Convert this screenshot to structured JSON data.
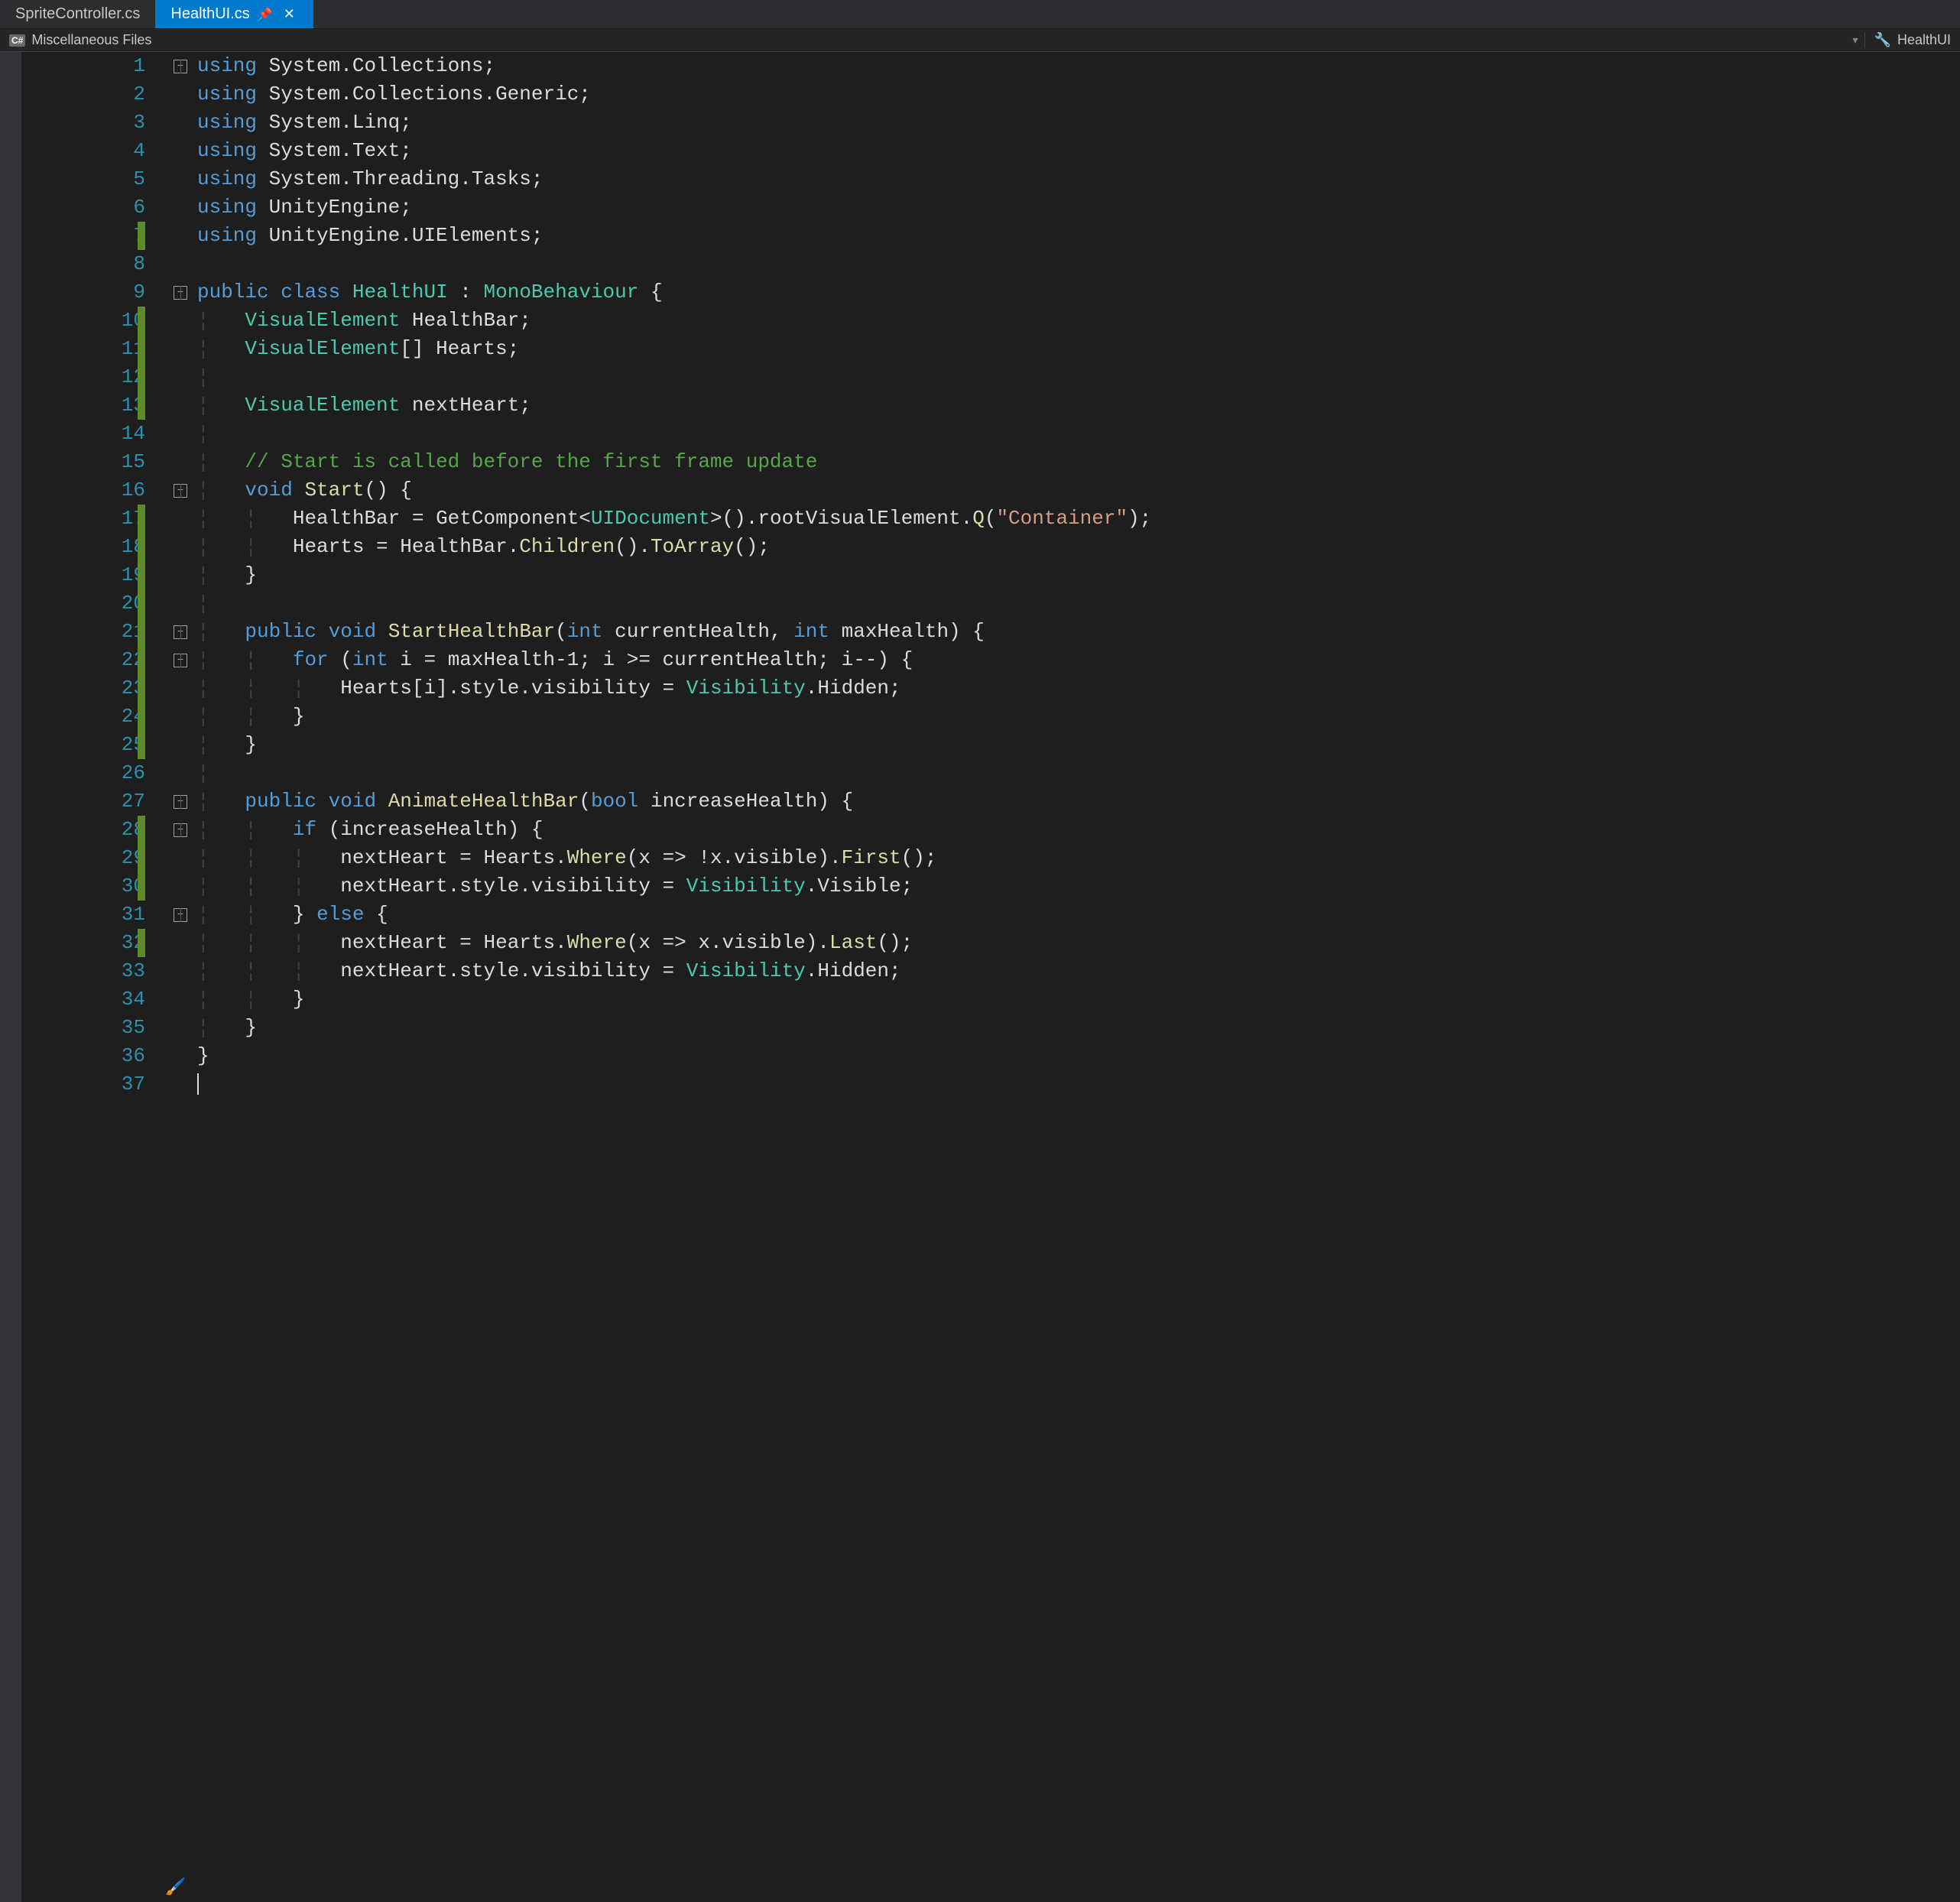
{
  "tabs": {
    "inactive": "SpriteController.cs",
    "active": "HealthUI.cs"
  },
  "context": {
    "left_label": "Miscellaneous Files",
    "right_label": "HealthUI"
  },
  "lines": [
    {
      "n": "1",
      "fold": "minus",
      "mark": false,
      "html": "<span class='kw'>using</span> <span class='pln'>System.Collections;</span>"
    },
    {
      "n": "2",
      "fold": "line",
      "mark": false,
      "html": "<span class='kw'>using</span> <span class='pln'>System.Collections.Generic;</span>"
    },
    {
      "n": "3",
      "fold": "line",
      "mark": false,
      "html": "<span class='kw'>using</span> <span class='pln'>System.Linq;</span>"
    },
    {
      "n": "4",
      "fold": "line",
      "mark": false,
      "html": "<span class='kw'>using</span> <span class='pln'>System.Text;</span>"
    },
    {
      "n": "5",
      "fold": "line",
      "mark": false,
      "html": "<span class='kw'>using</span> <span class='pln'>System.Threading.Tasks;</span>"
    },
    {
      "n": "6",
      "fold": "line",
      "mark": false,
      "html": "<span class='kw'>using</span> <span class='pln'>UnityEngine;</span>"
    },
    {
      "n": "7",
      "fold": "line",
      "mark": true,
      "html": "<span class='kw'>using</span> <span class='pln'>UnityEngine.UIElements;</span>"
    },
    {
      "n": "8",
      "fold": "none",
      "mark": false,
      "html": ""
    },
    {
      "n": "9",
      "fold": "minus",
      "mark": false,
      "html": "<span class='kw'>public</span> <span class='kw'>class</span> <span class='type'>HealthUI</span> <span class='pln'>:</span> <span class='type'>MonoBehaviour</span> <span class='pln'>{</span>"
    },
    {
      "n": "10",
      "fold": "line",
      "mark": true,
      "html": "<span class='guide'>&#x00A6;</span>   <span class='type'>VisualElement</span> <span class='pln'>HealthBar;</span>"
    },
    {
      "n": "11",
      "fold": "line",
      "mark": true,
      "html": "<span class='guide'>&#x00A6;</span>   <span class='type'>VisualElement</span><span class='pln'>[] Hearts;</span>"
    },
    {
      "n": "12",
      "fold": "line",
      "mark": true,
      "html": "<span class='guide'>&#x00A6;</span>"
    },
    {
      "n": "13",
      "fold": "line",
      "mark": true,
      "html": "<span class='guide'>&#x00A6;</span>   <span class='type'>VisualElement</span> <span class='pln'>nextHeart;</span>"
    },
    {
      "n": "14",
      "fold": "line",
      "mark": false,
      "html": "<span class='guide'>&#x00A6;</span>"
    },
    {
      "n": "15",
      "fold": "line",
      "mark": false,
      "html": "<span class='guide'>&#x00A6;</span>   <span class='cmt'>// Start is called before the first frame update</span>"
    },
    {
      "n": "16",
      "fold": "minus2",
      "mark": false,
      "html": "<span class='guide'>&#x00A6;</span>   <span class='kw'>void</span> <span class='mth'>Start</span><span class='pln'>() {</span>"
    },
    {
      "n": "17",
      "fold": "line2",
      "mark": true,
      "html": "<span class='guide'>&#x00A6;</span>   <span class='guide'>&#x00A6;</span>   <span class='pln'>HealthBar = GetComponent&lt;</span><span class='type'>UIDocument</span><span class='pln'>&gt;().rootVisualElement.</span><span class='mth'>Q</span><span class='pln'>(</span><span class='str'>\"Container\"</span><span class='pln'>);</span>"
    },
    {
      "n": "18",
      "fold": "line2",
      "mark": true,
      "html": "<span class='guide'>&#x00A6;</span>   <span class='guide'>&#x00A6;</span>   <span class='pln'>Hearts = HealthBar.</span><span class='mth'>Children</span><span class='pln'>().</span><span class='mth'>ToArray</span><span class='pln'>();</span>"
    },
    {
      "n": "19",
      "fold": "line",
      "mark": true,
      "html": "<span class='guide'>&#x00A6;</span>   <span class='pln'>}</span>"
    },
    {
      "n": "20",
      "fold": "line",
      "mark": true,
      "html": "<span class='guide'>&#x00A6;</span>"
    },
    {
      "n": "21",
      "fold": "minus2",
      "mark": true,
      "html": "<span class='guide'>&#x00A6;</span>   <span class='kw'>public</span> <span class='kw'>void</span> <span class='mth'>StartHealthBar</span><span class='pln'>(</span><span class='kw'>int</span> <span class='pln'>currentHealth,</span> <span class='kw'>int</span> <span class='pln'>maxHealth) {</span>"
    },
    {
      "n": "22",
      "fold": "minus3",
      "mark": true,
      "html": "<span class='guide'>&#x00A6;</span>   <span class='guide'>&#x00A6;</span>   <span class='kw'>for</span> <span class='pln'>(</span><span class='kw'>int</span> <span class='pln'>i = maxHealth-1; i &gt;= currentHealth; i--) {</span>"
    },
    {
      "n": "23",
      "fold": "line3",
      "mark": true,
      "html": "<span class='guide'>&#x00A6;</span>   <span class='guide'>&#x00A6;</span>   <span class='guide'>&#x00A6;</span>   <span class='pln'>Hearts[i].style.visibility = </span><span class='type'>Visibility</span><span class='pln'>.Hidden;</span>"
    },
    {
      "n": "24",
      "fold": "line2",
      "mark": true,
      "html": "<span class='guide'>&#x00A6;</span>   <span class='guide'>&#x00A6;</span>   <span class='pln'>}</span>"
    },
    {
      "n": "25",
      "fold": "line",
      "mark": true,
      "html": "<span class='guide'>&#x00A6;</span>   <span class='pln'>}</span>"
    },
    {
      "n": "26",
      "fold": "line",
      "mark": false,
      "html": "<span class='guide'>&#x00A6;</span>"
    },
    {
      "n": "27",
      "fold": "minus2",
      "mark": false,
      "html": "<span class='guide'>&#x00A6;</span>   <span class='kw'>public</span> <span class='kw'>void</span> <span class='mth'>AnimateHealthBar</span><span class='pln'>(</span><span class='kw'>bool</span> <span class='pln'>increaseHealth) {</span>"
    },
    {
      "n": "28",
      "fold": "minus3",
      "mark": true,
      "html": "<span class='guide'>&#x00A6;</span>   <span class='guide'>&#x00A6;</span>   <span class='kw'>if</span> <span class='pln'>(increaseHealth) {</span>"
    },
    {
      "n": "29",
      "fold": "line3",
      "mark": true,
      "html": "<span class='guide'>&#x00A6;</span>   <span class='guide'>&#x00A6;</span>   <span class='guide'>&#x00A6;</span>   <span class='pln'>nextHeart = Hearts.</span><span class='mth'>Where</span><span class='pln'>(x =&gt; !x.visible).</span><span class='mth'>First</span><span class='pln'>();</span>"
    },
    {
      "n": "30",
      "fold": "line3",
      "mark": true,
      "html": "<span class='guide'>&#x00A6;</span>   <span class='guide'>&#x00A6;</span>   <span class='guide'>&#x00A6;</span>   <span class='pln'>nextHeart.style.visibility = </span><span class='type'>Visibility</span><span class='pln'>.Visible;</span>"
    },
    {
      "n": "31",
      "fold": "minus3",
      "mark": false,
      "html": "<span class='guide'>&#x00A6;</span>   <span class='guide'>&#x00A6;</span>   <span class='pln'>}</span> <span class='kw'>else</span> <span class='pln'>{</span>"
    },
    {
      "n": "32",
      "fold": "line3",
      "mark": true,
      "html": "<span class='guide'>&#x00A6;</span>   <span class='guide'>&#x00A6;</span>   <span class='guide'>&#x00A6;</span>   <span class='pln'>nextHeart = Hearts.</span><span class='mth'>Where</span><span class='pln'>(x =&gt; x.visible).</span><span class='mth'>Last</span><span class='pln'>();</span>"
    },
    {
      "n": "33",
      "fold": "line3",
      "mark": false,
      "html": "<span class='guide'>&#x00A6;</span>   <span class='guide'>&#x00A6;</span>   <span class='guide'>&#x00A6;</span>   <span class='pln'>nextHeart.style.visibility = </span><span class='type'>Visibility</span><span class='pln'>.Hidden;</span>"
    },
    {
      "n": "34",
      "fold": "line2",
      "mark": false,
      "html": "<span class='guide'>&#x00A6;</span>   <span class='guide'>&#x00A6;</span>   <span class='pln'>}</span>"
    },
    {
      "n": "35",
      "fold": "line",
      "mark": false,
      "html": "<span class='guide'>&#x00A6;</span>   <span class='pln'>}</span>"
    },
    {
      "n": "36",
      "fold": "line",
      "mark": false,
      "html": "<span class='pln'>}</span>"
    },
    {
      "n": "37",
      "fold": "line",
      "mark": false,
      "html": "<span class='caret'></span>"
    }
  ]
}
